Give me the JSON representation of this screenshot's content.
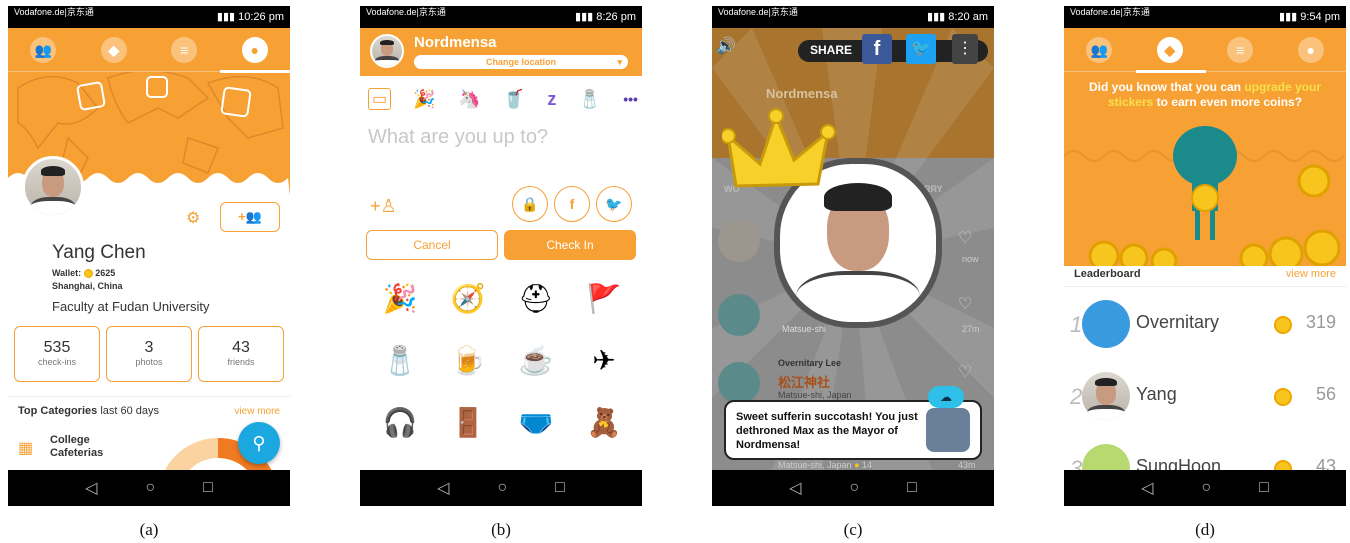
{
  "captions": [
    "(a)",
    "(b)",
    "(c)",
    "(d)"
  ],
  "panel_a": {
    "status": {
      "carrier": "Vodafone.de|京东通信 Netz",
      "time": "10:26 pm"
    },
    "name": "Yang Chen",
    "wallet_label": "Wallet:",
    "wallet_value": "2625",
    "location": "Shanghai, China",
    "bio": "Faculty at Fudan University",
    "stats": [
      {
        "value": "535",
        "label": "check-ins"
      },
      {
        "value": "3",
        "label": "photos"
      },
      {
        "value": "43",
        "label": "friends"
      }
    ],
    "top_categories_title": "Top Categories",
    "top_categories_period": "last 60 days",
    "view_more": "view more",
    "category": "College Cafeterias",
    "accent": "#f7a135",
    "fab_color": "#1ba8e0"
  },
  "panel_b": {
    "status": {
      "carrier": "Vodafone.de|京东通信 o2 - de",
      "time": "8:26 pm"
    },
    "venue": "Nordmensa",
    "change_location": "Change location",
    "composer_placeholder": "What are you up to?",
    "cancel": "Cancel",
    "check_in": "Check In",
    "more_dots": "•••"
  },
  "panel_c": {
    "status": {
      "carrier": "Vodafone.de|京东通信 Netz",
      "time": "8:20 am"
    },
    "share": "SHARE",
    "venue": "Nordmensa",
    "timeline_now": "now",
    "row_times": [
      "now",
      "27m",
      "43m"
    ],
    "row_name": "Overnitary Lee",
    "row_venue_jp": "松江神社",
    "row_place": "Matsue-shi, Japan",
    "row_place2": "Matsue-shi, Japan",
    "row_coins": "14",
    "row_partial": "Matsue-shi",
    "toast": "Sweet sufferin succotash! You just dethroned Max as the Mayor of Nordmensa!",
    "tab_left": "WO",
    "tab_right": "RRY"
  },
  "panel_d": {
    "status": {
      "carrier": "Vodafone.de|京东通信 o2 - de",
      "time": "9:54 pm"
    },
    "promo_prefix": "Did you know that you can ",
    "promo_link": "upgrade your stickers",
    "promo_suffix": " to earn even more coins?",
    "leaderboard_title": "Leaderboard",
    "view_more": "view more",
    "leaders": [
      {
        "rank": "1",
        "name": "Overnitary",
        "coins": "319"
      },
      {
        "rank": "2",
        "name": "Yang",
        "coins": "56"
      },
      {
        "rank": "3",
        "name": "SungHoon",
        "coins": "43"
      }
    ],
    "link_color": "#f7d341"
  }
}
